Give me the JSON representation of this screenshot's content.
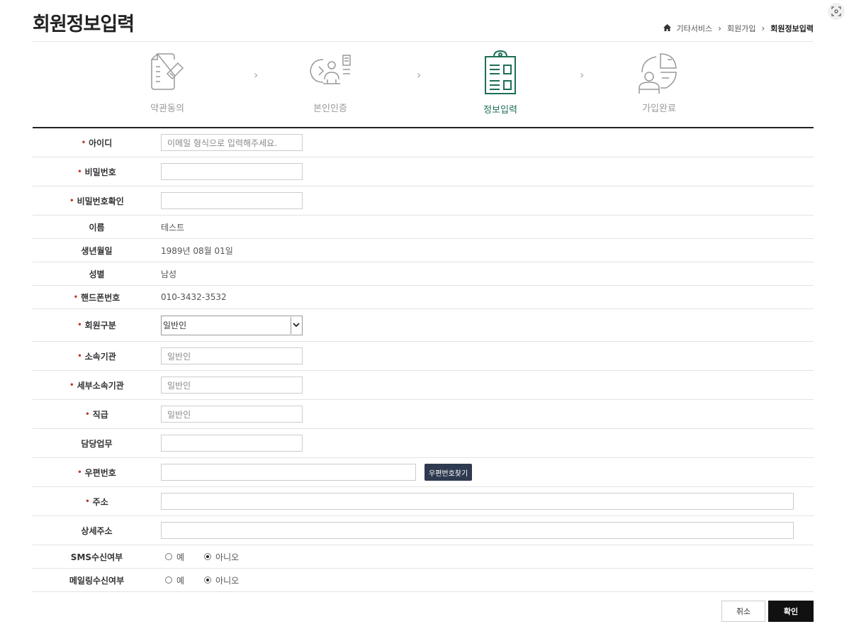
{
  "page": {
    "title": "회원정보입력",
    "breadcrumb": [
      "기타서비스",
      "회원가입",
      "회원정보입력"
    ]
  },
  "steps": [
    {
      "label": "약관동의",
      "icon": "document-check-icon",
      "active": false
    },
    {
      "label": "본인인증",
      "icon": "identity-verify-icon",
      "active": false
    },
    {
      "label": "정보입력",
      "icon": "clipboard-form-icon",
      "active": true
    },
    {
      "label": "가입완료",
      "icon": "user-chart-icon",
      "active": false
    }
  ],
  "form": {
    "id_label": "아이디",
    "id_placeholder": "이메일 형식으로 입력해주세요.",
    "password_label": "비밀번호",
    "password_confirm_label": "비밀번호확인",
    "name_label": "이름",
    "name_value": "테스트",
    "birth_label": "생년월일",
    "birth_value": "1989년 08월 01일",
    "gender_label": "성별",
    "gender_value": "남성",
    "phone_label": "핸드폰번호",
    "phone_value": "010-3432-3532",
    "member_type_label": "회원구분",
    "member_type_value": "일반인",
    "org_label": "소속기관",
    "org_value": "일반인",
    "sub_org_label": "세부소속기관",
    "sub_org_value": "일반인",
    "position_label": "직급",
    "position_value": "일반인",
    "duty_label": "담당업무",
    "zip_label": "우편번호",
    "zip_button": "우편번호찾기",
    "address_label": "주소",
    "address_detail_label": "상세주소",
    "sms_label": "SMS수신여부",
    "mail_label": "메일링수신여부",
    "yes_label": "예",
    "no_label": "아니오",
    "sms_selected": "no",
    "mail_selected": "no"
  },
  "actions": {
    "cancel": "취소",
    "confirm": "확인"
  },
  "colors": {
    "accent": "#1d6f58",
    "required": "#c0392b",
    "zip_button": "#2e3a4f",
    "confirm": "#111111"
  }
}
